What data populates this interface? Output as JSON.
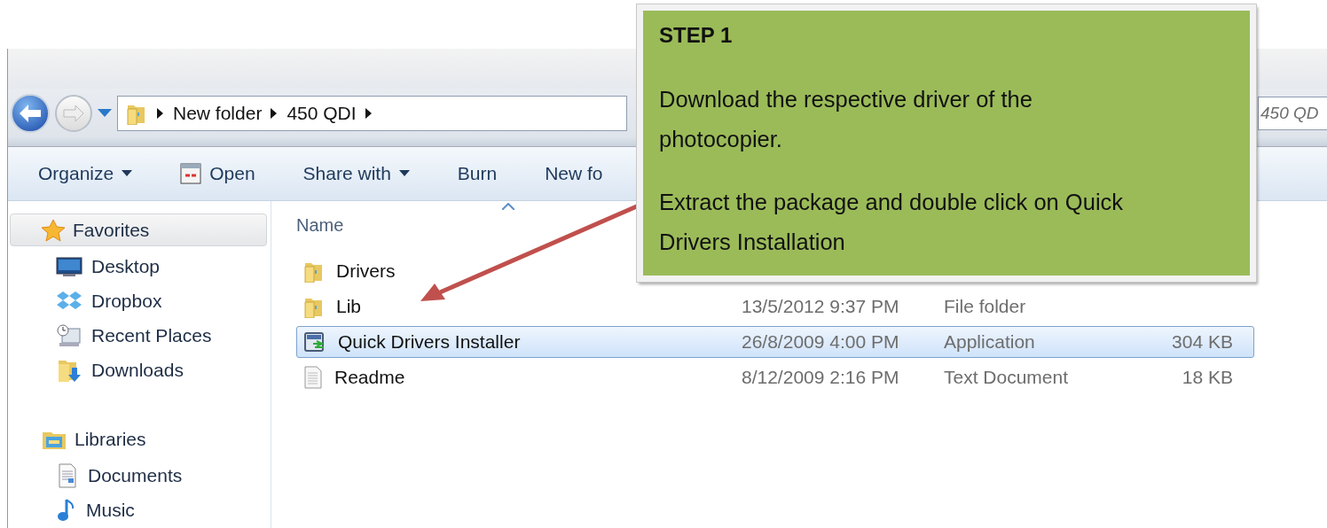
{
  "navigation": {
    "path": [
      "New folder",
      "450 QDI"
    ]
  },
  "search": {
    "placeholder": "450 QD"
  },
  "toolbar": [
    {
      "label": "Organize",
      "kind": "menu"
    },
    {
      "label": "Open",
      "kind": "icon"
    },
    {
      "label": "Share with",
      "kind": "menu"
    },
    {
      "label": "Burn",
      "kind": "plain"
    },
    {
      "label": "New fo",
      "kind": "plain"
    }
  ],
  "sidebar": {
    "groups": [
      {
        "label": "Favorites",
        "selected": true,
        "items": [
          {
            "label": "Desktop"
          },
          {
            "label": "Dropbox"
          },
          {
            "label": "Recent Places"
          },
          {
            "label": "Downloads"
          }
        ]
      },
      {
        "label": "Libraries",
        "selected": false,
        "items": [
          {
            "label": "Documents"
          },
          {
            "label": "Music"
          }
        ]
      }
    ]
  },
  "file_list": {
    "columns": [
      {
        "label": "Name",
        "sorted": true
      }
    ],
    "rows": [
      {
        "kind": "folder",
        "name": "Drivers",
        "selected": false
      },
      {
        "kind": "folder",
        "name": "Lib",
        "date": "13/5/2012 9:37 PM",
        "type": "File folder",
        "selected": false
      },
      {
        "kind": "application",
        "name": "Quick Drivers Installer",
        "date": "26/8/2009 4:00 PM",
        "type": "Application",
        "size": "304 KB",
        "selected": true
      },
      {
        "kind": "document",
        "name": "Readme",
        "date": "8/12/2009 2:16 PM",
        "type": "Text Document",
        "size": "18 KB",
        "selected": false
      }
    ]
  },
  "callout": {
    "title": "STEP 1",
    "paragraphs": [
      "Download the respective driver of the photocopier.",
      "Extract the package and double click on Quick Drivers Installation"
    ]
  }
}
